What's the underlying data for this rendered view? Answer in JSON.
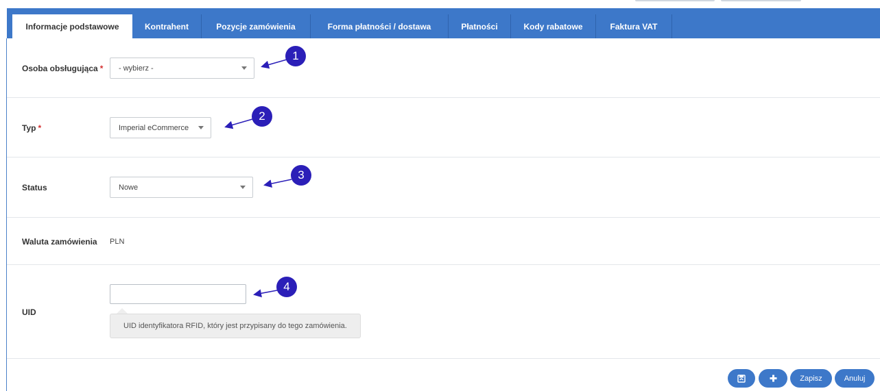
{
  "tabs": [
    {
      "label": "Informacje podstawowe"
    },
    {
      "label": "Kontrahent"
    },
    {
      "label": "Pozycje zamówienia"
    },
    {
      "label": "Forma płatności / dostawa"
    },
    {
      "label": "Płatności"
    },
    {
      "label": "Kody rabatowe"
    },
    {
      "label": "Faktura VAT"
    }
  ],
  "fields": {
    "osoba": {
      "label": "Osoba obsługująca",
      "required_mark": "*",
      "value": "- wybierz -"
    },
    "typ": {
      "label": "Typ",
      "required_mark": "*",
      "value": "Imperial eCommerce"
    },
    "status": {
      "label": "Status",
      "value": "Nowe"
    },
    "waluta": {
      "label": "Waluta zamówienia",
      "value": "PLN"
    },
    "uid": {
      "label": "UID",
      "value": "",
      "tooltip": "UID identyfikatora RFID, który jest przypisany do tego zamówienia."
    }
  },
  "markers": [
    "1",
    "2",
    "3",
    "4"
  ],
  "buttons": {
    "save_label": "Zapisz",
    "cancel_label": "Anuluj",
    "icon_save": "save-return-icon",
    "icon_add": "plus-icon"
  },
  "colors": {
    "accent": "#3d78c9",
    "marker": "#2b1fb8",
    "required": "#d32f2f"
  }
}
